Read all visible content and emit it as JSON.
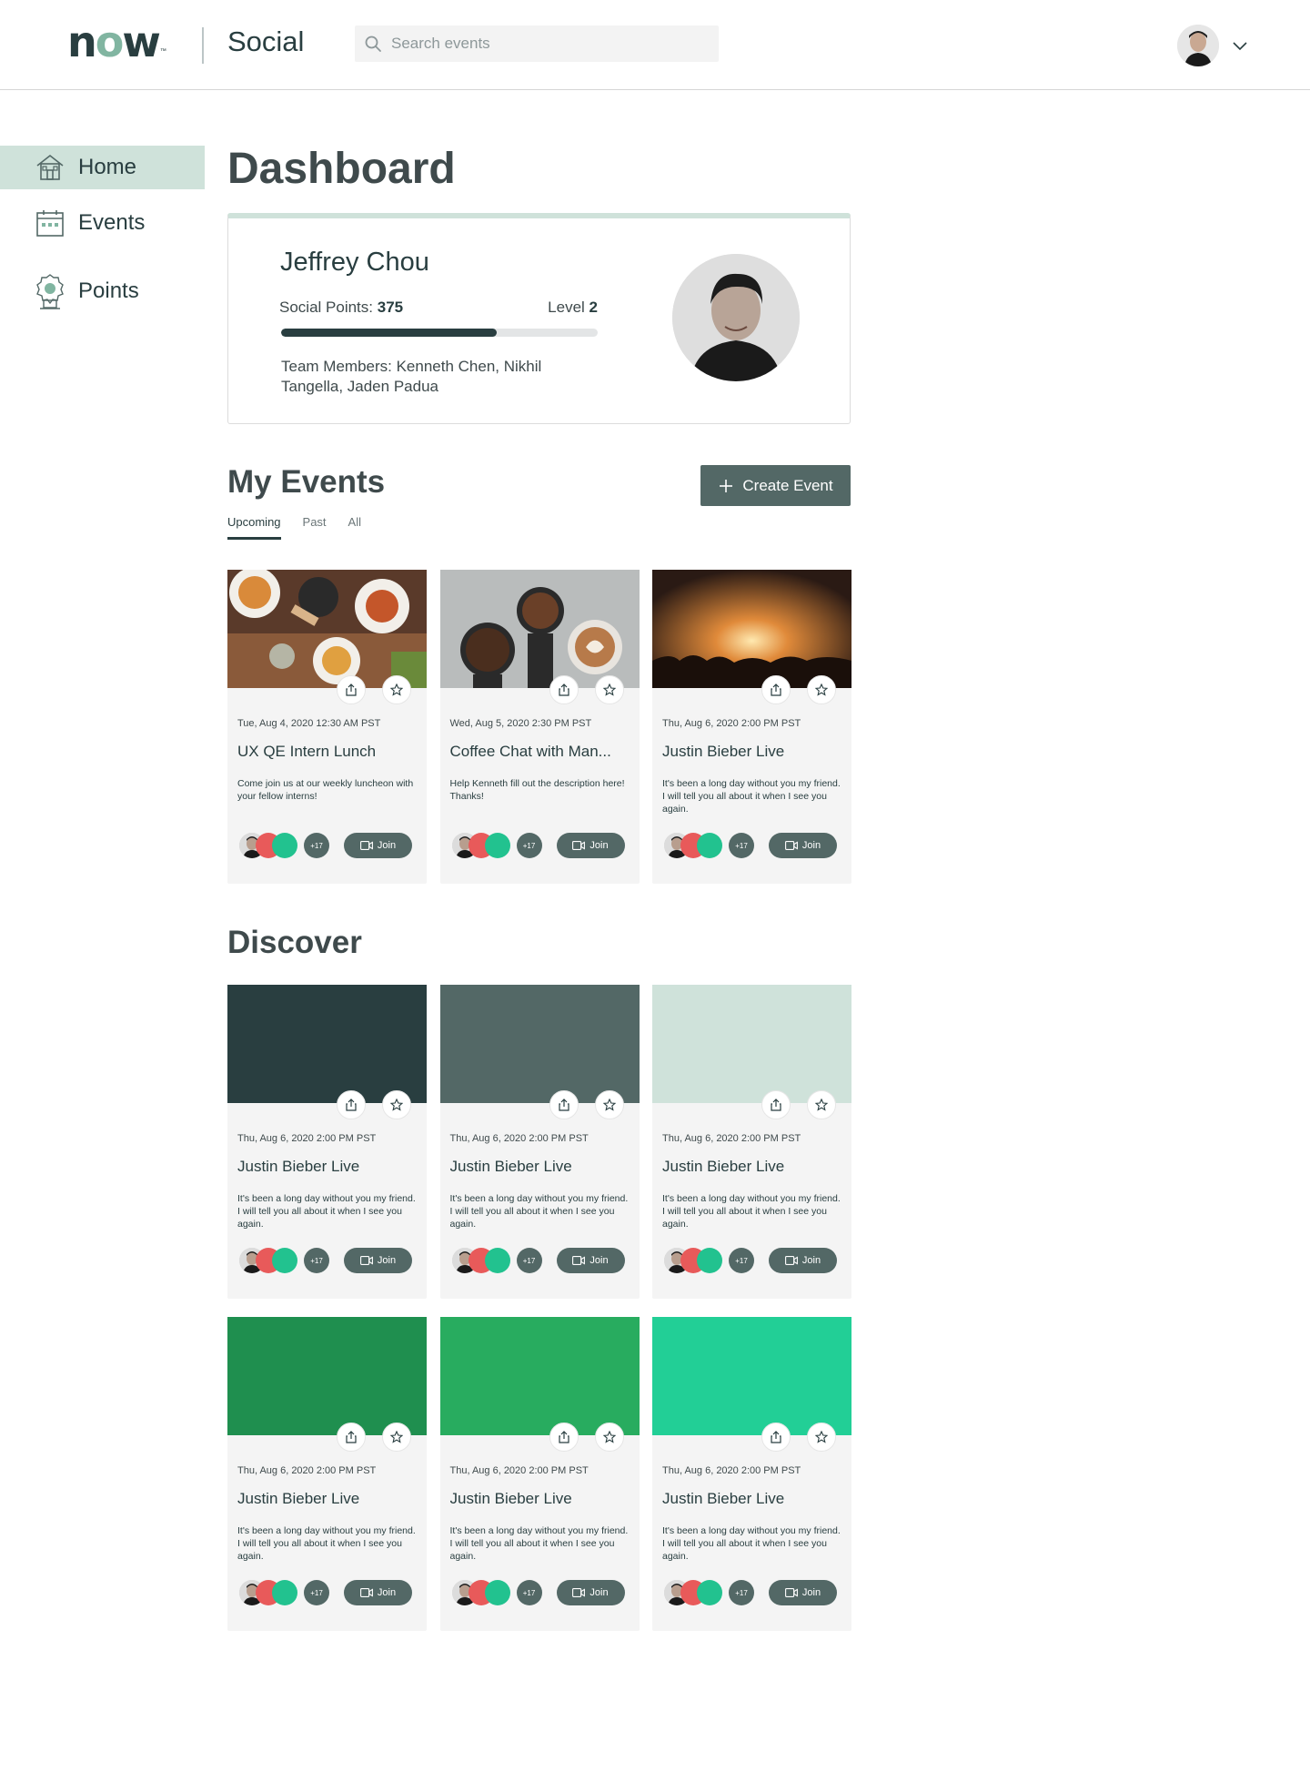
{
  "header": {
    "logo_text_n": "n",
    "logo_text_o": "o",
    "logo_text_w": "w",
    "logo_tm": "™",
    "app_name": "Social",
    "search_placeholder": "Search events",
    "search_icon": "search-icon",
    "menu_icon": "chevron-down-icon"
  },
  "sidebar": {
    "items": [
      {
        "label": "Home",
        "icon": "home-icon",
        "active": true
      },
      {
        "label": "Events",
        "icon": "calendar-icon",
        "active": false
      },
      {
        "label": "Points",
        "icon": "award-icon",
        "active": false
      }
    ]
  },
  "dashboard": {
    "title": "Dashboard",
    "profile": {
      "name": "Jeffrey Chou",
      "points_label": "Social Points: ",
      "points_value": "375",
      "level_label": "Level ",
      "level_value": "2",
      "progress_fraction": 0.68,
      "team_text": "Team Members: Kenneth Chen, Nikhil Tangella, Jaden Padua"
    }
  },
  "my_events": {
    "title": "My Events",
    "create_label": "Create Event",
    "tabs": [
      {
        "label": "Upcoming",
        "active": true
      },
      {
        "label": "Past",
        "active": false
      },
      {
        "label": "All",
        "active": false
      }
    ],
    "cards": [
      {
        "date": "Tue, Aug 4, 2020 12:30 AM PST",
        "title": "UX QE Intern Lunch",
        "desc": "Come join us at our weekly luncheon with your fellow interns!",
        "more": "+17",
        "join": "Join",
        "image": "food-photo"
      },
      {
        "date": "Wed, Aug 5, 2020 2:30 PM PST",
        "title": "Coffee Chat with Man...",
        "desc": "Help Kenneth fill out the description here! Thanks!",
        "more": "+17",
        "join": "Join",
        "image": "coffee-photo"
      },
      {
        "date": "Thu, Aug 6, 2020 2:00 PM PST",
        "title": "Justin Bieber Live",
        "desc": "It's been a long day without you my friend. I will tell you all about it when I see you again.",
        "more": "+17",
        "join": "Join",
        "image": "concert-photo"
      }
    ]
  },
  "discover": {
    "title": "Discover",
    "cards": [
      {
        "date": "Thu, Aug 6, 2020 2:00 PM PST",
        "title": "Justin Bieber Live",
        "desc": "It's been a long day without you my friend. I will tell you all about it when I see you again.",
        "more": "+17",
        "join": "Join",
        "color": "#293e40"
      },
      {
        "date": "Thu, Aug 6, 2020 2:00 PM PST",
        "title": "Justin Bieber Live",
        "desc": "It's been a long day without you my friend. I will tell you all about it when I see you again.",
        "more": "+17",
        "join": "Join",
        "color": "#536866"
      },
      {
        "date": "Thu, Aug 6, 2020 2:00 PM PST",
        "title": "Justin Bieber Live",
        "desc": "It's been a long day without you my friend. I will tell you all about it when I see you again.",
        "more": "+17",
        "join": "Join",
        "color": "#cfe2da"
      },
      {
        "date": "Thu, Aug 6, 2020 2:00 PM PST",
        "title": "Justin Bieber Live",
        "desc": "It's been a long day without you my friend. I will tell you all about it when I see you again.",
        "more": "+17",
        "join": "Join",
        "color": "#1f8f4f"
      },
      {
        "date": "Thu, Aug 6, 2020 2:00 PM PST",
        "title": "Justin Bieber Live",
        "desc": "It's been a long day without you my friend. I will tell you all about it when I see you again.",
        "more": "+17",
        "join": "Join",
        "color": "#28ac5f"
      },
      {
        "date": "Thu, Aug 6, 2020 2:00 PM PST",
        "title": "Justin Bieber Live",
        "desc": "It's been a long day without you my friend. I will tell you all about it when I see you again.",
        "more": "+17",
        "join": "Join",
        "color": "#22cf96"
      }
    ]
  },
  "colors": {
    "brand_dark": "#293e40",
    "brand_green": "#81b5a1",
    "accent_light": "#cfe2da",
    "button": "#536866"
  }
}
